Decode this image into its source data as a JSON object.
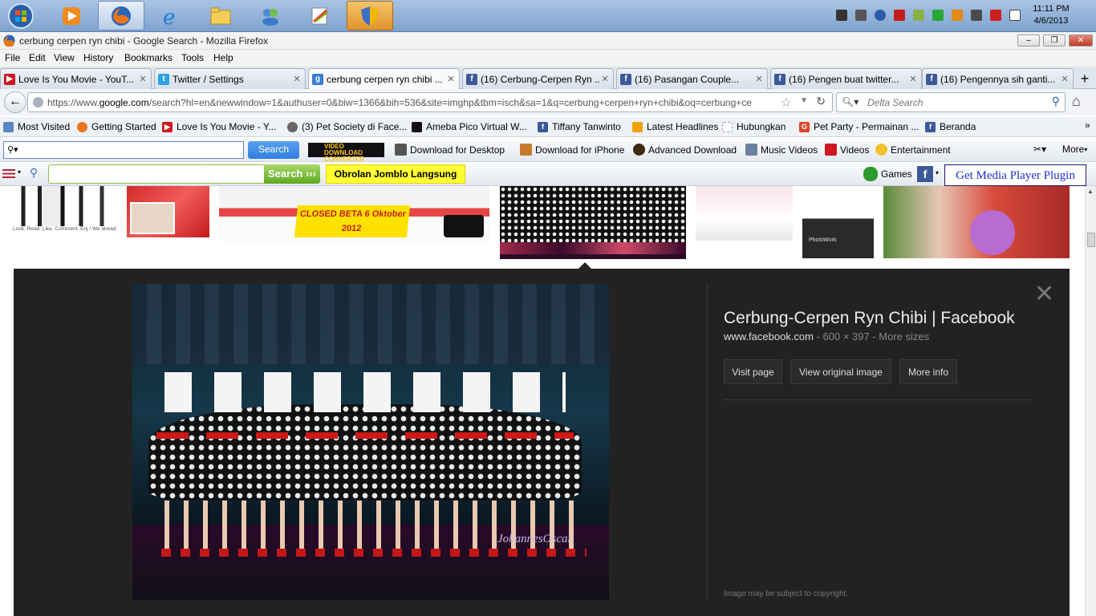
{
  "taskbar": {
    "pinned": [
      "start-orb-icon",
      "media-player-icon",
      "firefox-icon",
      "internet-explorer-icon",
      "file-explorer-icon",
      "people-icon",
      "notepad-icon",
      "security-shield-icon"
    ],
    "clock": {
      "time": "11:11 PM",
      "date": "4/6/2013"
    }
  },
  "window": {
    "title": "cerbung cerpen ryn chibi - Google Search - Mozilla Firefox"
  },
  "menu": [
    "File",
    "Edit",
    "View",
    "History",
    "Bookmarks",
    "Tools",
    "Help"
  ],
  "tabs": [
    {
      "label": "Love Is You Movie - YouT...",
      "icon": "youtube-icon",
      "color": "#cc181e",
      "active": false
    },
    {
      "label": "Twitter / Settings",
      "icon": "twitter-icon",
      "color": "#2ea2e6",
      "active": false
    },
    {
      "label": "cerbung cerpen ryn chibi ...",
      "icon": "google-icon",
      "color": "#3a7bd5",
      "active": true
    },
    {
      "label": "(16) Cerbung-Cerpen Ryn ...",
      "icon": "facebook-icon",
      "color": "#3b5998",
      "active": false
    },
    {
      "label": "(16) Pasangan Couple...",
      "icon": "facebook-icon",
      "color": "#3b5998",
      "active": false
    },
    {
      "label": "(16) Pengen buat twitter...",
      "icon": "facebook-icon",
      "color": "#3b5998",
      "active": false
    },
    {
      "label": "(16) Pengennya sih ganti...",
      "icon": "facebook-icon",
      "color": "#3b5998",
      "active": false
    }
  ],
  "nav": {
    "url_prefix": "https://www.",
    "url_domain": "google.com",
    "url_rest": "/search?hl=en&newwindow=1&authuser=0&biw=1366&bih=536&site=imghp&tbm=isch&sa=1&q=cerbung+cerpen+ryn+chibi&oq=cerbung+ce",
    "search_placeholder": "Delta Search"
  },
  "bookmarks": [
    {
      "label": "Most Visited",
      "color": "#5b86c5"
    },
    {
      "label": "Getting Started",
      "color": "#e8761f"
    },
    {
      "label": "Love Is You Movie - Y...",
      "color": "#cc181e"
    },
    {
      "label": "(3) Pet Society di Face...",
      "color": "#666666"
    },
    {
      "label": "Ameba Pico Virtual W...",
      "color": "#111111"
    },
    {
      "label": "Tiffany Tanwinto",
      "color": "#3b5998"
    },
    {
      "label": "Latest Headlines",
      "color": "#f0a30a"
    },
    {
      "label": "Hubungkan",
      "color": "#ffffff"
    },
    {
      "label": "Pet Party - Permainan ...",
      "color": "#e0452b"
    },
    {
      "label": "Beranda",
      "color": "#3b5998"
    }
  ],
  "toolbar1": {
    "search_button": "Search",
    "items": [
      "Download for Desktop",
      "Download for iPhone",
      "Advanced Download",
      "Music Videos",
      "Videos",
      "Entertainment"
    ],
    "more": "More",
    "brand": "VIDEO DOWNLOAD CONVERTER"
  },
  "toolbar2": {
    "search_button": "Search",
    "promo": "Obrolan Jomblo Langsung",
    "games": "Games",
    "plugin": "Get Media Player Plugin"
  },
  "thumbs": [
    {
      "caption": "Look. Read. Like. Comment. Enj / We already of all yourgood idea, g"
    },
    {
      "caption": ""
    },
    {
      "caption": "CLOSED BETA 6 Oktober 2012"
    },
    {
      "caption": ""
    },
    {
      "caption": ""
    },
    {
      "caption": "PhotoWork"
    },
    {
      "caption": ""
    }
  ],
  "preview": {
    "title": "Cerbung-Cerpen Ryn Chibi | Facebook",
    "domain": "www.facebook.com",
    "meta": " - 600 × 397 - More sizes",
    "buttons": [
      "Visit page",
      "View original image",
      "More info"
    ],
    "copyright": "Image may be subject to copyright.",
    "watermark": "JohannesOscar"
  },
  "colors": {
    "accent_search": "#2f7ee0",
    "promo_yellow": "#ffff33",
    "panel": "#222222"
  }
}
